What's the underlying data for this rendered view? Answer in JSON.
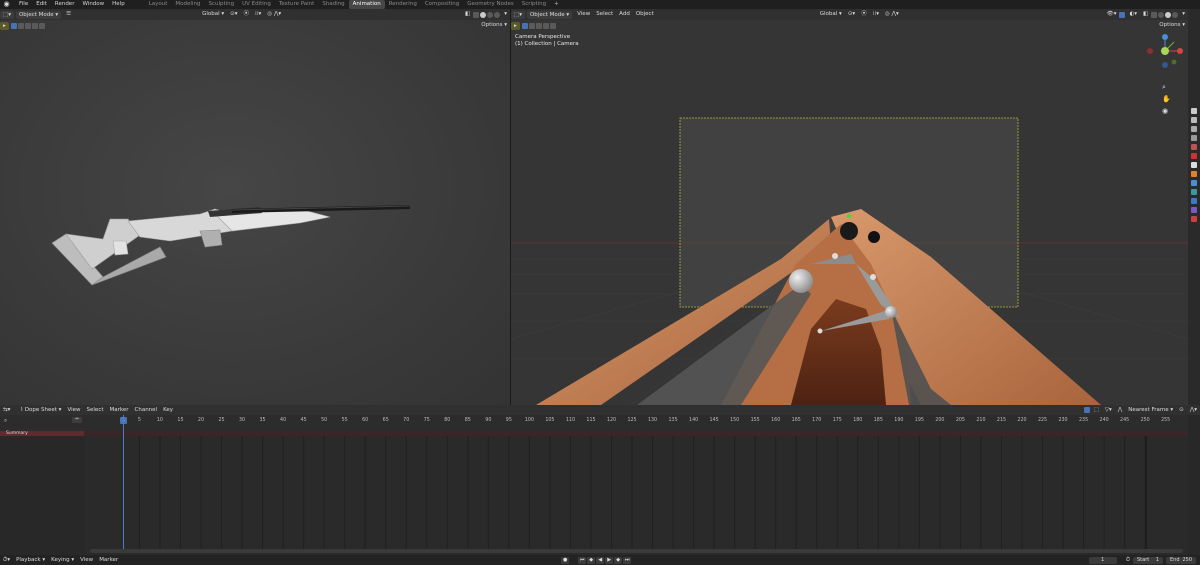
{
  "menu": [
    "File",
    "Edit",
    "Render",
    "Window",
    "Help"
  ],
  "workspaces": [
    "Layout",
    "Modeling",
    "Sculpting",
    "UV Editing",
    "Texture Paint",
    "Shading",
    "Animation",
    "Rendering",
    "Compositing",
    "Geometry Nodes",
    "Scripting",
    "+"
  ],
  "left_viewport": {
    "mode": "Object Mode",
    "transform_orientation": "Global",
    "options": "Options"
  },
  "right_viewport": {
    "mode": "Object Mode",
    "menus": [
      "View",
      "Select",
      "Add",
      "Object"
    ],
    "transform_orientation": "Global",
    "options": "Options",
    "camera_info_line1": "Camera Perspective",
    "camera_info_line2": "(1) Collection | Camera",
    "gizmo_axes": {
      "z": "Z",
      "y": "Y",
      "x": "X"
    }
  },
  "dopesheet": {
    "editor": "Dope Sheet",
    "menus": [
      "View",
      "Select",
      "Marker",
      "Channel",
      "Key"
    ],
    "snap": "Nearest Frame",
    "summary_label": "Summary",
    "current_frame_label": "1",
    "ruler_ticks": [
      "5",
      "10",
      "15",
      "20",
      "25",
      "30",
      "35",
      "40",
      "45",
      "50",
      "55",
      "60",
      "65",
      "70",
      "75",
      "80",
      "85",
      "90",
      "95",
      "100",
      "105",
      "110",
      "115",
      "120",
      "125",
      "130",
      "135",
      "140",
      "145",
      "150",
      "155",
      "160",
      "165",
      "170",
      "175",
      "180",
      "185",
      "190",
      "195",
      "200",
      "205",
      "210",
      "215",
      "220",
      "225",
      "230",
      "235",
      "240",
      "245",
      "250",
      "255"
    ]
  },
  "playback_bar": {
    "menus": [
      "Playback",
      "Keying",
      "View",
      "Marker"
    ],
    "current_frame": "1",
    "start_label": "Start",
    "start_value": "1",
    "end_label": "End",
    "end_value": "250"
  },
  "colors": {
    "accent": "#4772b3",
    "playhead": "#4a7cc8",
    "camera_frame": "#b5b53a",
    "wood": "#c27a4e",
    "summary": "#5e2c2e"
  }
}
